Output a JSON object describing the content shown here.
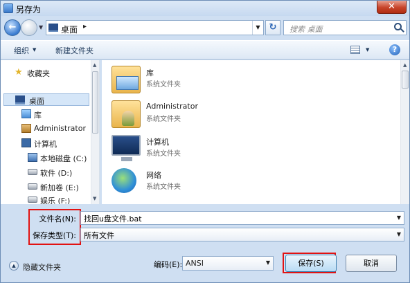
{
  "window": {
    "title": "另存为",
    "close_label": "✕"
  },
  "address": {
    "location": "桌面",
    "separator": "▸",
    "back_glyph": "←",
    "refresh_glyph": "↻",
    "search_placeholder": "搜索 桌面"
  },
  "toolbar": {
    "organize_label": "组织",
    "new_folder_label": "新建文件夹",
    "help_glyph": "?"
  },
  "nav_pane": {
    "items": [
      {
        "label": "收藏夹",
        "icon": "star-icon"
      },
      {
        "label": "桌面",
        "icon": "desktop-icon",
        "selected": true
      },
      {
        "label": "库",
        "icon": "library-icon"
      },
      {
        "label": "Administrator",
        "icon": "user-folder-icon"
      },
      {
        "label": "计算机",
        "icon": "computer-icon"
      },
      {
        "label": "本地磁盘 (C:)",
        "icon": "system-drive-icon"
      },
      {
        "label": "软件 (D:)",
        "icon": "drive-icon"
      },
      {
        "label": "新加卷 (E:)",
        "icon": "drive-icon"
      },
      {
        "label": "娱乐 (F:)",
        "icon": "drive-icon"
      }
    ]
  },
  "content": {
    "items": [
      {
        "name": "库",
        "type": "系统文件夹",
        "icon": "library-icon"
      },
      {
        "name": "Administrator",
        "type": "系统文件夹",
        "icon": "user-folder-icon"
      },
      {
        "name": "计算机",
        "type": "系统文件夹",
        "icon": "computer-icon"
      },
      {
        "name": "网络",
        "type": "系统文件夹",
        "icon": "network-icon"
      }
    ]
  },
  "fields": {
    "filename_label": "文件名(N):",
    "filename_value": "找回u盘文件.bat",
    "filetype_label": "保存类型(T):",
    "filetype_value": "所有文件"
  },
  "footer": {
    "hide_folders_label": "隐藏文件夹",
    "encoding_label": "编码(E):",
    "encoding_value": "ANSI",
    "save_label": "保存(S)",
    "cancel_label": "取消"
  },
  "colors": {
    "highlight_box": "#e21212",
    "selected_nav": "#d5e6f8"
  }
}
